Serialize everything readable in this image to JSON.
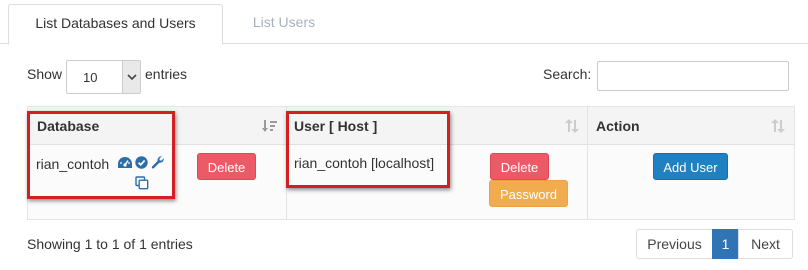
{
  "tabs": [
    {
      "label": "List Databases and Users",
      "active": true
    },
    {
      "label": "List Users",
      "active": false
    }
  ],
  "controls": {
    "show_label": "Show",
    "entries_value": "10",
    "entries_label": "entries",
    "search_label": "Search:",
    "search_value": ""
  },
  "table": {
    "columns": [
      "Database",
      "User [ Host ]",
      "Action"
    ],
    "rows": [
      {
        "database": "rian_contoh",
        "database_delete_label": "Delete",
        "user_host": "rian_contoh [localhost]",
        "user_delete_label": "Delete",
        "user_password_label": "Password",
        "action_add_user_label": "Add User"
      }
    ]
  },
  "footer": {
    "info": "Showing 1 to 1 of 1 entries",
    "prev_label": "Previous",
    "current_page": "1",
    "next_label": "Next"
  },
  "colors": {
    "delete": "#ec5a67",
    "password": "#f0ac4f",
    "add_user": "#1f80c2",
    "highlight_box": "#d11f24",
    "icon_blue": "#2d6da8"
  },
  "icons": [
    "dashboard-icon",
    "check-circle-icon",
    "wrench-icon",
    "copy-icon",
    "sort-icon",
    "sort-desc-icon"
  ]
}
